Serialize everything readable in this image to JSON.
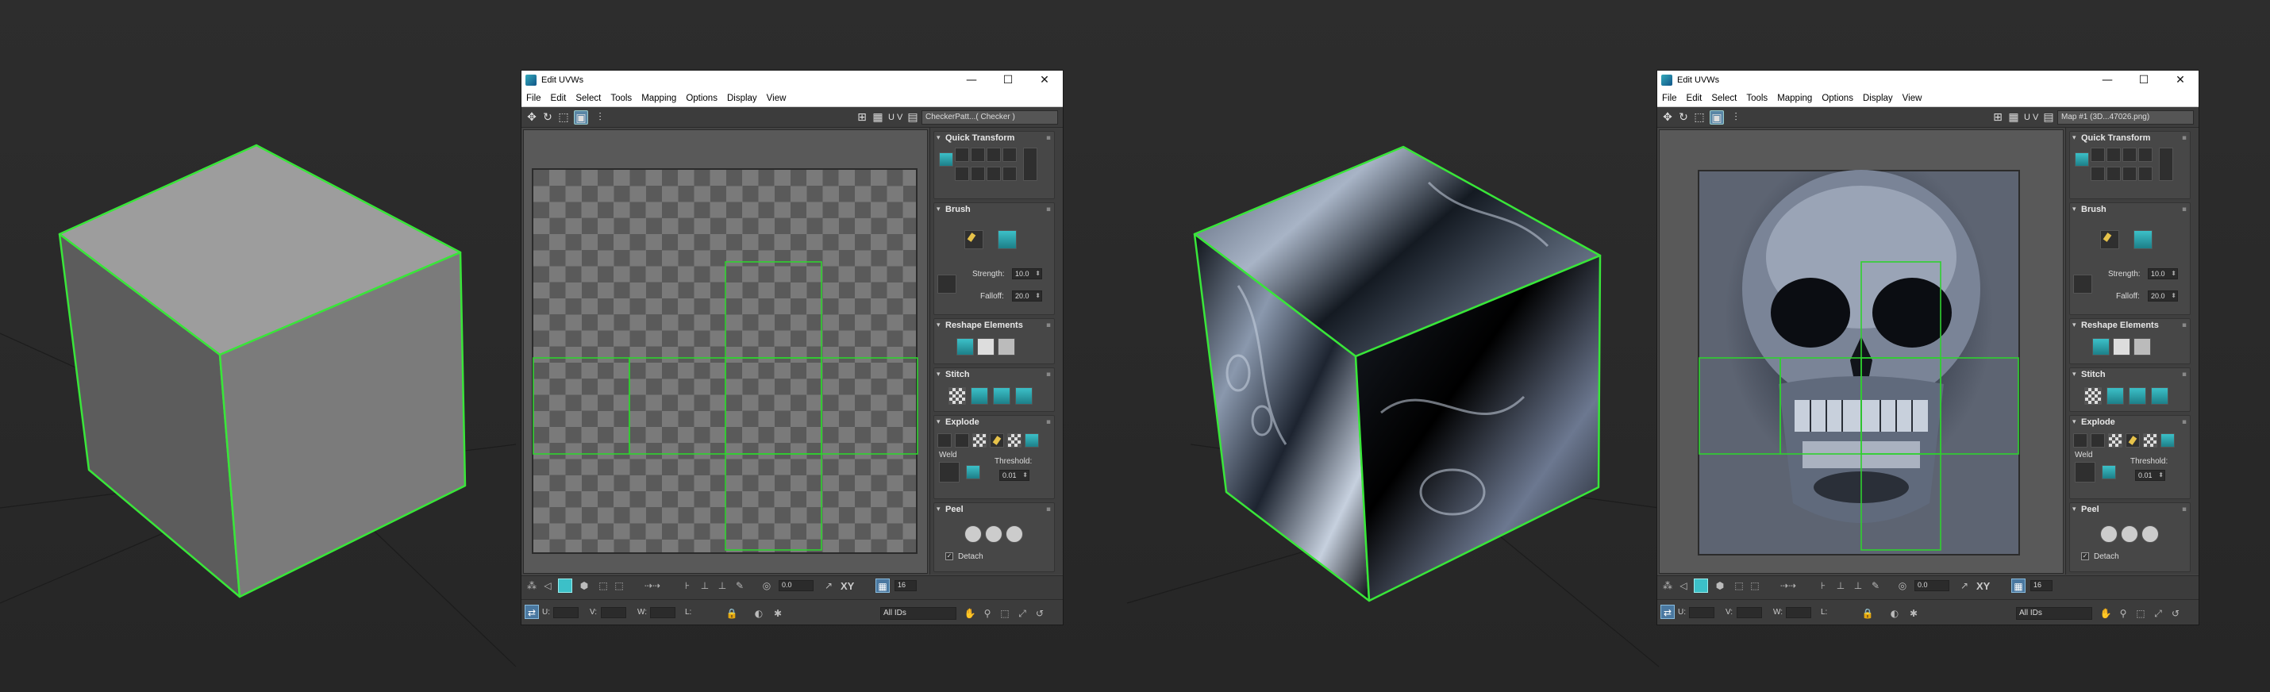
{
  "windows": [
    {
      "id": "checker",
      "title": "Edit UVWs",
      "controls": [
        "—",
        "☐",
        "✕"
      ],
      "menu": [
        "File",
        "Edit",
        "Select",
        "Tools",
        "Mapping",
        "Options",
        "Display",
        "View"
      ],
      "uv_label": "U V",
      "map_selector": "CheckerPatt...( Checker )",
      "texture": "checker"
    },
    {
      "id": "skull",
      "title": "Edit UVWs",
      "controls": [
        "—",
        "☐",
        "✕"
      ],
      "menu": [
        "File",
        "Edit",
        "Select",
        "Tools",
        "Mapping",
        "Options",
        "Display",
        "View"
      ],
      "uv_label": "U V",
      "map_selector": "Map #1 (3D...47026.png)",
      "texture": "skull"
    }
  ],
  "panel": {
    "quick_transform": "Quick Transform",
    "brush": "Brush",
    "strength_label": "Strength:",
    "strength_value": "10.0",
    "falloff_label": "Falloff:",
    "falloff_value": "20.0",
    "reshape": "Reshape Elements",
    "stitch": "Stitch",
    "explode": "Explode",
    "weld": "Weld",
    "threshold_label": "Threshold:",
    "threshold_value": "0.01",
    "peel": "Peel",
    "detach": "Detach"
  },
  "bottom": {
    "angle_value": "0.0",
    "xy_label": "XY",
    "grid_value": "16",
    "u_label": "U:",
    "v_label": "V:",
    "w_label": "W:",
    "l_label": "L:",
    "ids_select": "All IDs"
  },
  "colors": {
    "selection_edge": "#39e639",
    "uv_seam": "#2fd12f",
    "accent_cyan": "#3cc0c8",
    "panel_bg": "#3f3f3f"
  }
}
